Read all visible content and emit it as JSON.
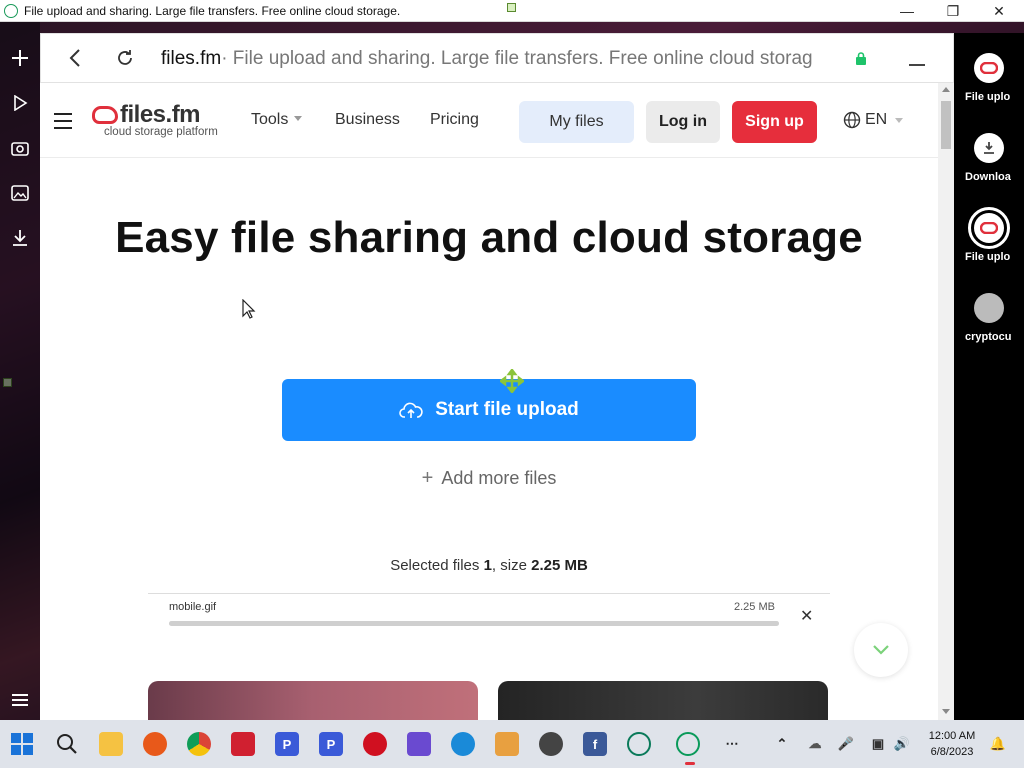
{
  "window": {
    "title": "File upload and sharing. Large file transfers. Free online cloud storage."
  },
  "browser": {
    "url_host": "files.fm",
    "url_rest": " · File upload and sharing. Large file transfers. Free online cloud storag"
  },
  "site": {
    "logo": {
      "brand": "files.fm",
      "tagline": "cloud storage platform"
    },
    "nav": {
      "tools": "Tools",
      "business": "Business",
      "pricing": "Pricing"
    },
    "buttons": {
      "my_files": "My files",
      "log_in": "Log in",
      "sign_up": "Sign up"
    },
    "language": "EN"
  },
  "hero": {
    "title": "Easy file sharing and cloud storage",
    "upload_button": "Start file upload",
    "add_more": "Add more files"
  },
  "selection": {
    "prefix": "Selected files ",
    "count": "1",
    "middle": ", size ",
    "size": "2.25 MB"
  },
  "files": [
    {
      "name": "mobile.gif",
      "size": "2.25 MB",
      "progress": 1.0
    }
  ],
  "right_sidebar": [
    {
      "label": "File uplo",
      "icon": "files-fm-logo-icon"
    },
    {
      "label": "Downloa",
      "icon": "download-icon"
    },
    {
      "label": "File uplo",
      "icon": "files-fm-logo-icon"
    },
    {
      "label": "cryptocu",
      "icon": "crypto-icon"
    }
  ],
  "taskbar": {
    "time": "12:00 AM",
    "date": "6/8/2023"
  },
  "colors": {
    "accent_blue": "#1a8cff",
    "brand_red": "#e62e3c",
    "my_files_bg": "#e4edfb"
  }
}
